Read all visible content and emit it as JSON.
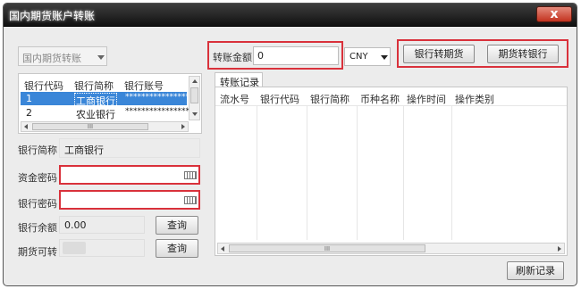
{
  "window": {
    "title": "国内期货账户转账",
    "close_label": "x"
  },
  "account_type": {
    "selected": "国内期货转账"
  },
  "bank_table": {
    "headers": [
      "银行代码",
      "银行简称",
      "银行账号"
    ],
    "rows": [
      {
        "code": "1",
        "name": "工商银行",
        "account": "****************"
      },
      {
        "code": "2",
        "name": "农业银行",
        "account": "****************"
      }
    ],
    "hscroll_grip": "III"
  },
  "form": {
    "bank_name_label": "银行简称",
    "bank_name_value": "工商银行",
    "fund_password_label": "资金密码",
    "bank_password_label": "银行密码",
    "bank_balance_label": "银行余额",
    "bank_balance_value": "0.00",
    "futures_transferable_label": "期货可转",
    "query_label": "查询"
  },
  "transfer": {
    "amount_label": "转账金额",
    "amount_value": "0",
    "currency": "CNY",
    "bank_to_futures": "银行转期货",
    "futures_to_bank": "期货转银行"
  },
  "records": {
    "tab_label": "转账记录",
    "headers": [
      "流水号",
      "银行代码",
      "银行简称",
      "币种名称",
      "操作时间",
      "操作类别"
    ],
    "hscroll_grip": "III",
    "refresh_label": "刷新记录"
  },
  "colors": {
    "highlight_red": "#d9313b",
    "selected_row": "#3a86d8",
    "titlebar": "#1a1a1a"
  },
  "icons": [
    "close-icon",
    "dropdown-arrow-icon",
    "keyboard-icon",
    "scroll-arrow-icon"
  ]
}
